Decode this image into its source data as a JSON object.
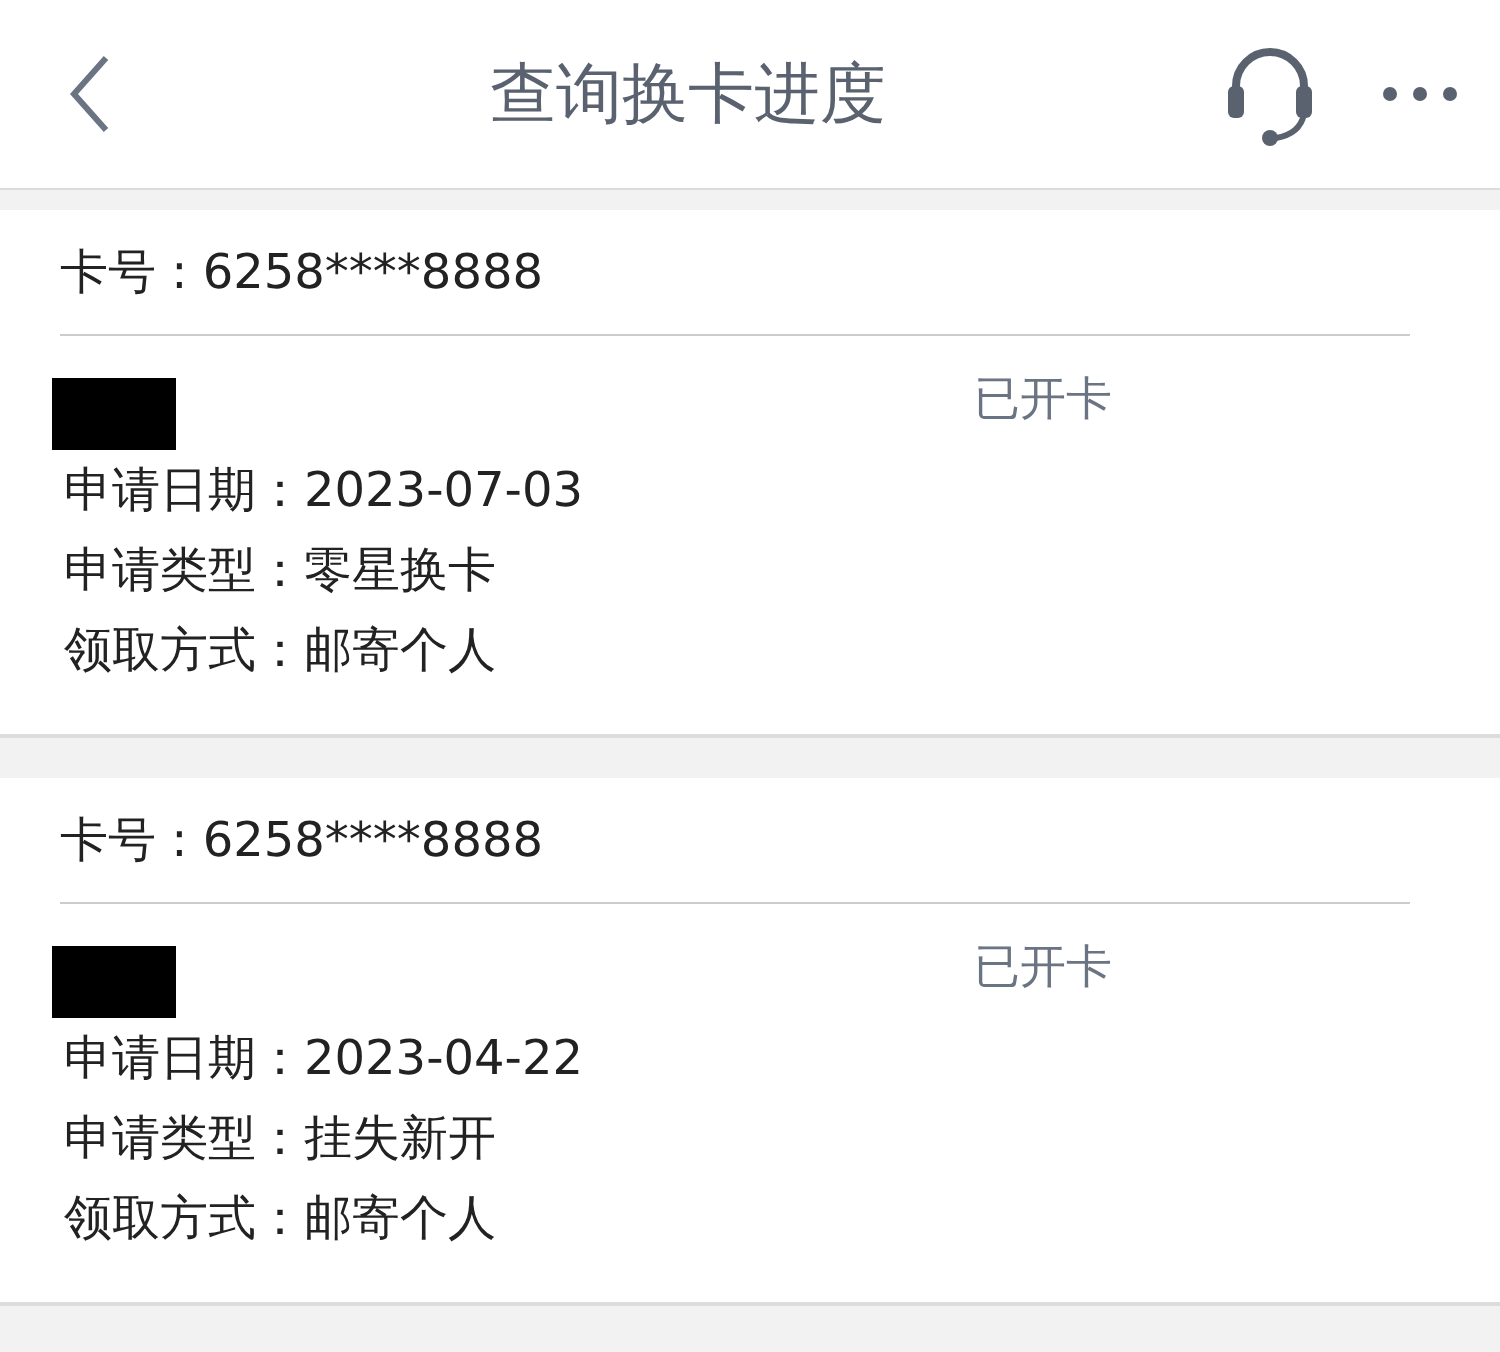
{
  "header": {
    "title": "查询换卡进度"
  },
  "cards": [
    {
      "card_number": "卡号 : 6258****8888",
      "status": "已开卡",
      "fields": [
        {
          "label": "申请日期：",
          "value": "2023-07-03"
        },
        {
          "label": "申请类型：",
          "value": "零星换卡"
        },
        {
          "label": "领取方式：",
          "value": "邮寄个人"
        }
      ]
    },
    {
      "card_number": "卡号 : 6258****8888",
      "status": "已开卡",
      "fields": [
        {
          "label": "申请日期：",
          "value": "2023-04-22"
        },
        {
          "label": "申请类型：",
          "value": "挂失新开"
        },
        {
          "label": "领取方式：",
          "value": "邮寄个人"
        }
      ]
    }
  ]
}
